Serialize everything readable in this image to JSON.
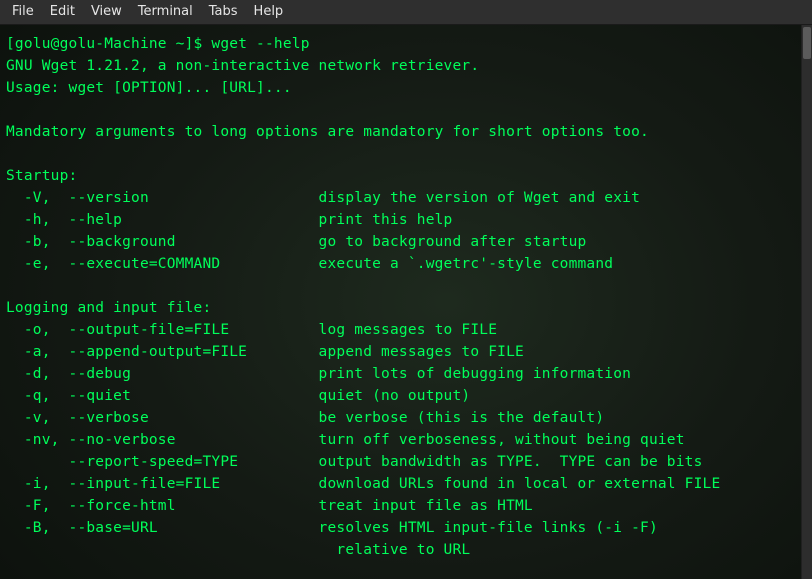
{
  "menubar": {
    "items": [
      "File",
      "Edit",
      "View",
      "Terminal",
      "Tabs",
      "Help"
    ]
  },
  "prompt": {
    "user_host": "[golu@golu-Machine ~]$",
    "command": "wget --help"
  },
  "output_lines": [
    "GNU Wget 1.21.2, a non-interactive network retriever.",
    "Usage: wget [OPTION]... [URL]...",
    "",
    "Mandatory arguments to long options are mandatory for short options too.",
    "",
    "Startup:",
    "  -V,  --version                   display the version of Wget and exit",
    "  -h,  --help                      print this help",
    "  -b,  --background                go to background after startup",
    "  -e,  --execute=COMMAND           execute a `.wgetrc'-style command",
    "",
    "Logging and input file:",
    "  -o,  --output-file=FILE          log messages to FILE",
    "  -a,  --append-output=FILE        append messages to FILE",
    "  -d,  --debug                     print lots of debugging information",
    "  -q,  --quiet                     quiet (no output)",
    "  -v,  --verbose                   be verbose (this is the default)",
    "  -nv, --no-verbose                turn off verboseness, without being quiet",
    "       --report-speed=TYPE         output bandwidth as TYPE.  TYPE can be bits",
    "  -i,  --input-file=FILE           download URLs found in local or external FILE",
    "  -F,  --force-html                treat input file as HTML",
    "  -B,  --base=URL                  resolves HTML input-file links (-i -F)",
    "                                     relative to URL"
  ]
}
